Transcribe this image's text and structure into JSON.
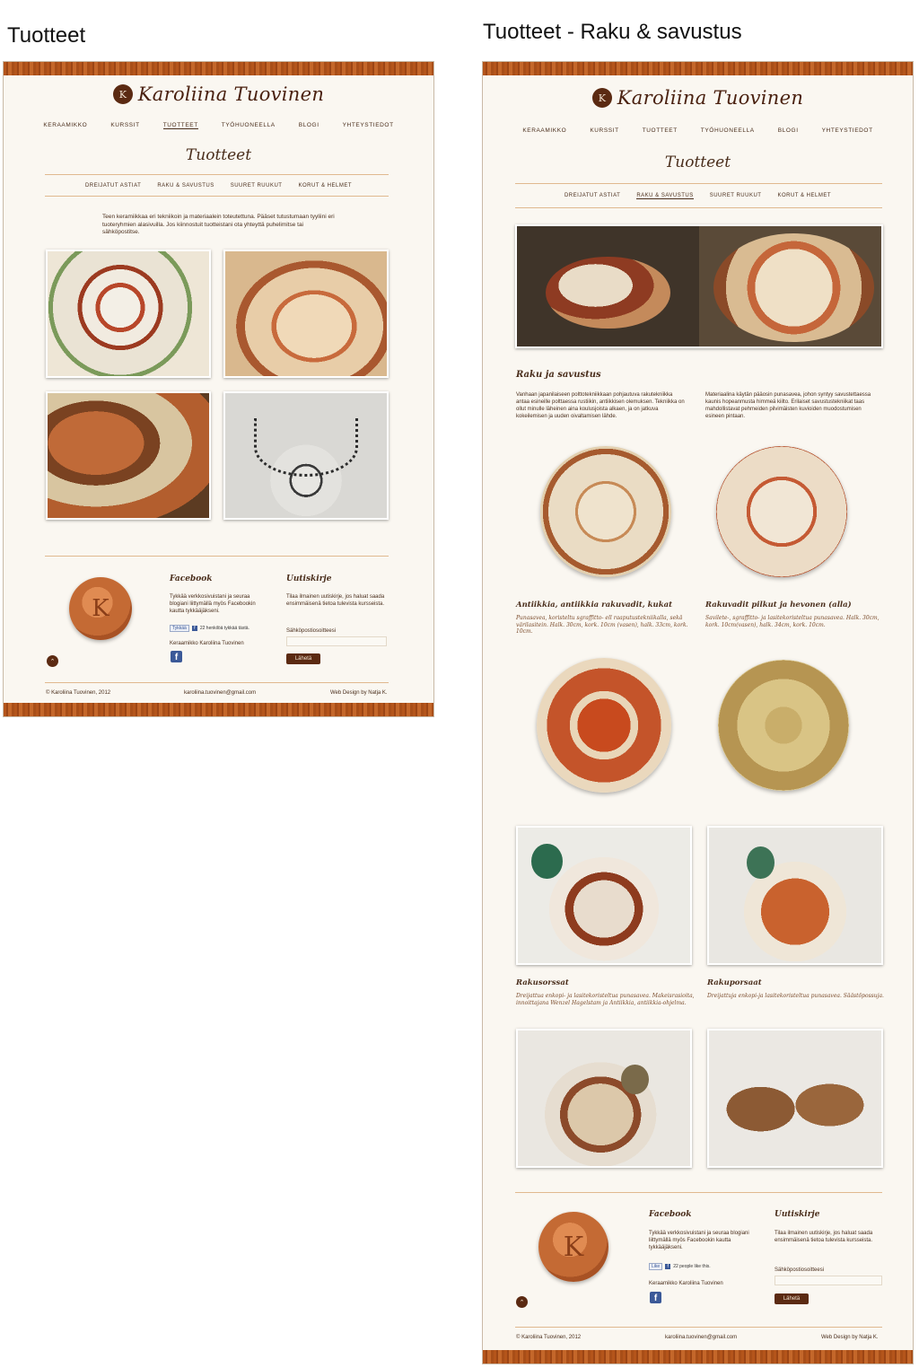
{
  "board": {
    "left_title": "Tuotteet",
    "right_title": "Tuotteet - Raku & savustus"
  },
  "site": {
    "logo_mark": "K",
    "logo_text": "Karoliina Tuovinen",
    "nav": [
      "KERAAMIKKO",
      "KURSSIT",
      "TUOTTEET",
      "TYÖHUONEELLA",
      "BLOGI",
      "YHTEYSTIEDOT"
    ],
    "nav_active": "TUOTTEET",
    "subnav": [
      "DREIJATUT ASTIAT",
      "RAKU & SAVUSTUS",
      "SUURET RUUKUT",
      "KORUT & HELMET"
    ]
  },
  "left_page": {
    "heading": "Tuotteet",
    "intro": "Teen keramiikkaa eri tekniikoin ja materiaalein toteutettuna. Pääset tutustumaan tyyliini eri tuoteryhmien alasivuilla. Jos kiinnostuit tuotteistani ota yhteyttä puhelimitse tai sähköpostitse.",
    "footer": {
      "facebook_heading": "Facebook",
      "facebook_text": "Tykkää verkkosivuistani ja seuraa blogiani liittymällä myös Facebookin kautta tykkääjäkseni.",
      "like_label": "Tykkää",
      "like_count": "22 henkilöä tykkää tästä.",
      "page_name": "Keraamikko Karoliina Tuovinen",
      "newsletter_heading": "Uutiskirje",
      "newsletter_text": "Tilaa ilmainen uutiskirje, jos haluat saada ensimmäisenä tietoa tulevista kursseista.",
      "email_label": "Sähköpostiosoitteesi",
      "send_label": "Lähetä",
      "copyright": "© Karoliina Tuovinen, 2012",
      "email": "karoliina.tuovinen@gmail.com",
      "credit": "Web Design by Natja K."
    }
  },
  "right_page": {
    "heading": "Tuotteet",
    "active_subnav": "RAKU & SAVUSTUS",
    "section_heading": "Raku ja savustus",
    "col1": "Vanhaan japanilaiseen polttotekniikkaan pohjautuva rakutekniikka antaa esineille polttaessa rustiikin, antiikkisen olemuksen. Tekniikka on ollut minulle läheinen aina koulusjoista alkaen, ja on jatkuva kokeilemisen ja uuden oivaltamisen lähde.",
    "col2": "Materiaalina käytän pääosin punasavea, johon syntyy savustettaessa kaunis hopeanmusta himmeä kiilto. Erilaiset savustustekniikat taas mahdollistavat pehmeiden pilvimäisten kuvioiden muodostumisen esineen pintaan.",
    "products": [
      {
        "title": "Antiikkia, antiikkia rakuvadit, kukat",
        "caption": "Punasavea, koristeltu sgraffitto- ell raaputustekniikalla, sekä värilasitein. Halk. 30cm, kork. 10cm (vasen), halk. 33cm, kork. 10cm."
      },
      {
        "title": "Rakuvadit pilkut ja hevonen (alla)",
        "caption": "Savilete-, sgraffitto- ja lasitekoristeltua punasavea. Halk. 30cm, kork. 10cm(vasen), halk. 34cm, kork. 10cm."
      },
      {
        "title": "Rakusorssat",
        "caption": "Dreijattua enkopi- ja lasitekoristeltua punasavea. Makeisrasioita, innoittajana Wenzel Hagelstam ja Antiikkia, antiikkia-ohjelma."
      },
      {
        "title": "Rakuporsaat",
        "caption": "Dreijattuja enkopi-ja lasitekoristeltua punasavea. Säästöpossuja."
      }
    ],
    "footer": {
      "facebook_heading": "Facebook",
      "facebook_text": "Tykkää verkkosivuistani ja seuraa blogiani liittymällä myös Facebookin kautta tykkääjäkseni.",
      "like_label": "Like",
      "like_count": "22 people like this.",
      "page_name": "Keraamikko Karoliina Tuovinen",
      "newsletter_heading": "Uutiskirje",
      "newsletter_text": "Tilaa ilmainen uutiskirje, jos haluat saada ensimmäisenä tietoa tulevista kursseista.",
      "email_label": "Sähköpostiosoitteesi",
      "send_label": "Lähetä",
      "copyright": "© Karoliina Tuovinen, 2012",
      "email": "karoliina.tuovinen@gmail.com",
      "credit": "Web Design by Natja K."
    }
  },
  "icons": {
    "up": "up-arrow-icon",
    "facebook": "facebook-icon"
  },
  "colors": {
    "accent_brown": "#5b2a12",
    "band_orange": "#b4551b",
    "rule_tan": "#e0b98f",
    "page_bg": "#faf7f1"
  }
}
